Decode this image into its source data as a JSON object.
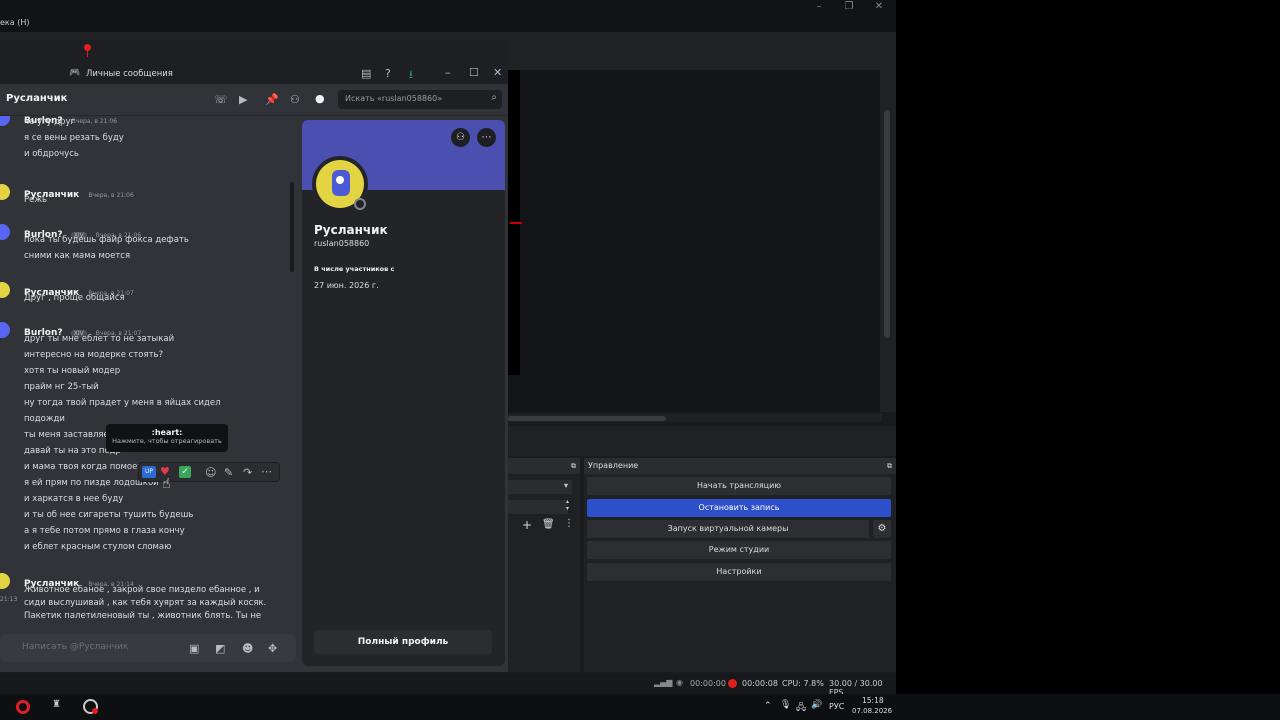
{
  "obs": {
    "window_title": "ека (H)",
    "controls_title": "Управление",
    "buttons": [
      "Начать трансляцию",
      "Остановить запись",
      "Запуск виртуальной камеры",
      "Режим студии",
      "Настройки"
    ],
    "status": {
      "stream_time": "00:00:00",
      "rec_time": "00:00:08",
      "cpu": "CPU: 7.8%",
      "fps": "30.00 / 30.00 FPS"
    }
  },
  "discord": {
    "top_title": "Личные сообщения",
    "header_name": "Русланчик",
    "search_placeholder": "Искать «ruslan058860»",
    "messages": [
      {
        "author": "Burlon?",
        "time": "Вчера, в 21:06",
        "lines": [
          "че угу друг",
          "я се вены резать буду",
          "и обдрочусь"
        ]
      },
      {
        "author": "Русланчик",
        "time": "Вчера, в 21:06",
        "lines": [
          "Режь"
        ]
      },
      {
        "author": "Burlon?",
        "badge": "XIV",
        "time": "Вчера, в 21:06",
        "lines": [
          "пока ты будешь файр фокса дефать",
          "сними как мама моется"
        ]
      },
      {
        "author": "Русланчик",
        "time": "Вчера, в 21:07",
        "lines": [
          "Друг , проще общайся"
        ]
      },
      {
        "author": "Burlon?",
        "badge": "XIV",
        "time": "Вчера, в 21:07",
        "lines": [
          "друг ты мне еблет то не затыкай",
          "интересно на модерке стоять?",
          "хотя ты новый модер",
          "прайм нг 25-тый",
          "ну тогда твой прадет у меня в яйцах сидел",
          "подожди",
          "ты меня заставляе",
          "давай ты на это подр",
          "и мама твоя когда помоем",
          "я ей прям по пизде лодошкой",
          "и харкатся в нее буду",
          "и ты об нее сигареты тушить будешь",
          "а я тебе потом прямо в глаза кончу",
          "и еблет красным стулом сломаю"
        ]
      },
      {
        "author": "Русланчик",
        "time": "Вчера, в 21:14",
        "lines": [
          "Животное ебаное , закрой свое пиздело ебанное , и",
          "сиди выслушивай , как тебя хуярят за каждый косяк.",
          "Пакетик палетиленовый ты , животник блять. Ты не"
        ]
      }
    ],
    "hover_time": "21:13",
    "tooltip": {
      "emoji": ":heart:",
      "hint": "Нажмите, чтобы отреагировать"
    },
    "input_placeholder": "Написать @Русланчик",
    "profile": {
      "display_name": "Русланчик",
      "username": "ruslan058860",
      "member_since_label": "В числе участников с",
      "member_since": "27 июн. 2026 г.",
      "full_profile_button": "Полный профиль"
    }
  },
  "taskbar": {
    "lang": "РУС",
    "time": "15:18",
    "date": "07.08.2026"
  }
}
